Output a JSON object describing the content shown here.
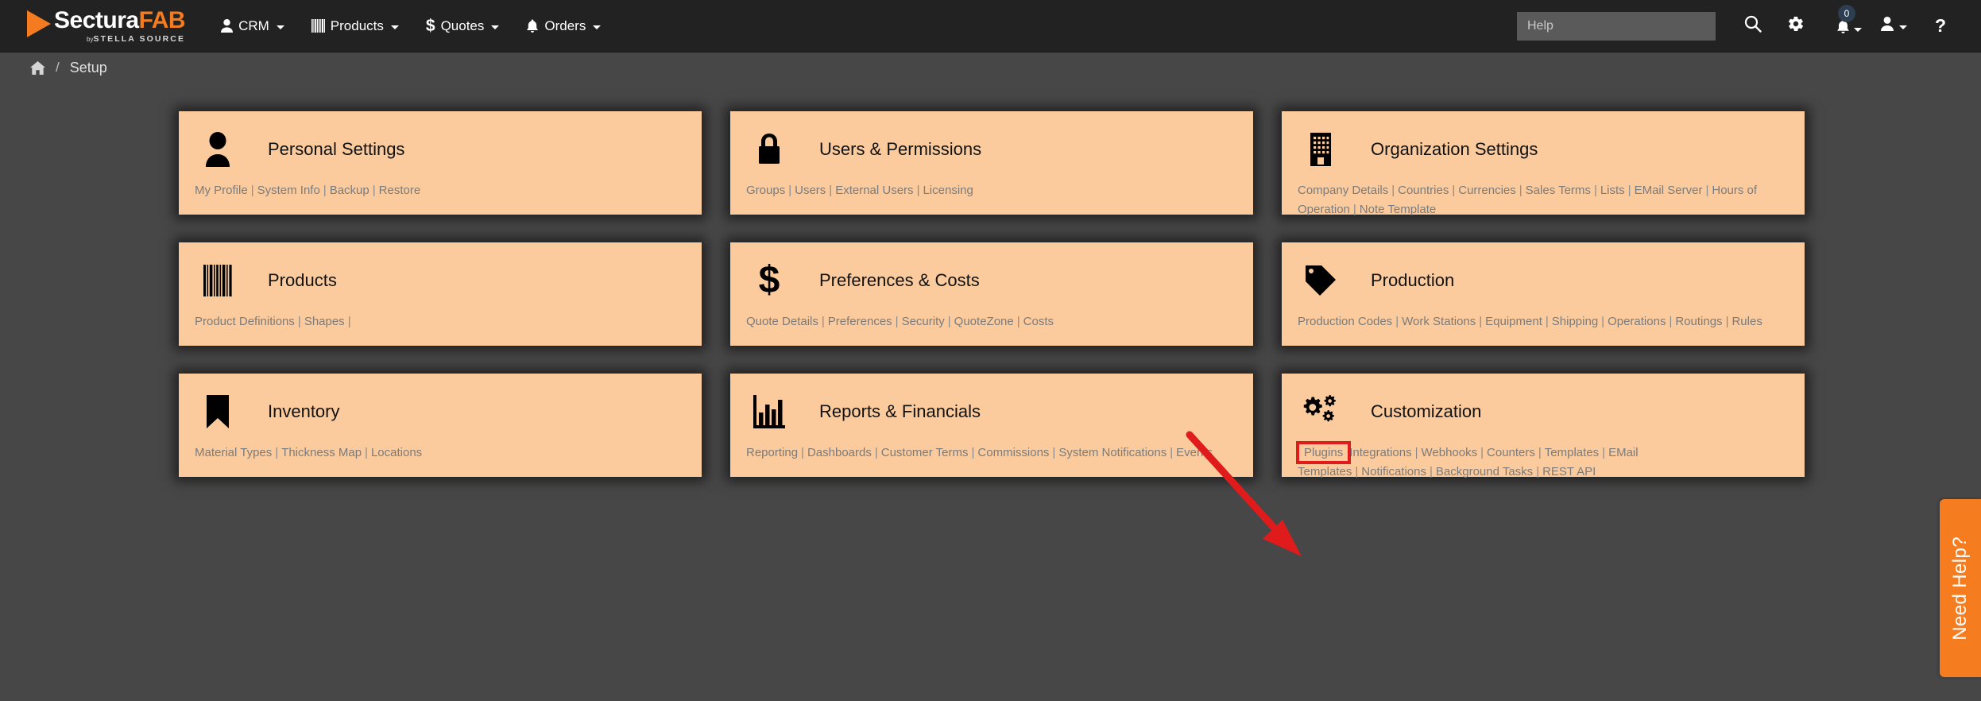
{
  "brand": {
    "name_part1": "Sectura",
    "name_part2": "FAB",
    "by": "by",
    "parent": "STELLA SOURCE",
    "accent_color": "#F47B20"
  },
  "topnav": {
    "items": [
      {
        "label": "CRM",
        "icon": "user-icon",
        "has_caret": true
      },
      {
        "label": "Products",
        "icon": "barcode-icon",
        "has_caret": true
      },
      {
        "label": "Quotes",
        "icon": "dollar-icon",
        "has_caret": true
      },
      {
        "label": "Orders",
        "icon": "bell-icon",
        "has_caret": true
      }
    ],
    "search": {
      "placeholder": "Help",
      "value": ""
    },
    "search_icon": "search-icon",
    "settings_icon": "gear-icon",
    "notifications_icon": "bell-icon",
    "notifications_count": "0",
    "account_icon": "user-icon",
    "help_icon": "question-mark-icon"
  },
  "breadcrumb": {
    "home_icon": "home-icon",
    "separator": "/",
    "current": "Setup"
  },
  "cards": [
    {
      "title": "Personal Settings",
      "icon": "person-icon",
      "links": [
        "My Profile",
        "System Info",
        "Backup",
        "Restore"
      ],
      "trailing_separator": false
    },
    {
      "title": "Users & Permissions",
      "icon": "lock-icon",
      "links": [
        "Groups",
        "Users",
        "External Users",
        "Licensing"
      ],
      "trailing_separator": false
    },
    {
      "title": "Organization Settings",
      "icon": "building-icon",
      "links": [
        "Company Details",
        "Countries",
        "Currencies",
        "Sales Terms",
        "Lists",
        "EMail Server",
        "Hours of Operation",
        "Note Template"
      ],
      "trailing_separator": false
    },
    {
      "title": "Products",
      "icon": "barcode-icon",
      "links": [
        "Product Definitions",
        "Shapes"
      ],
      "trailing_separator": true
    },
    {
      "title": "Preferences & Costs",
      "icon": "dollar-icon",
      "links": [
        "Quote Details",
        "Preferences",
        "Security",
        "QuoteZone",
        "Costs"
      ],
      "trailing_separator": false
    },
    {
      "title": "Production",
      "icon": "tag-icon",
      "links": [
        "Production Codes",
        "Work Stations",
        "Equipment",
        "Shipping",
        "Operations",
        "Routings",
        "Rules"
      ],
      "trailing_separator": false
    },
    {
      "title": "Inventory",
      "icon": "bookmark-icon",
      "links": [
        "Material Types",
        "Thickness Map",
        "Locations"
      ],
      "trailing_separator": false
    },
    {
      "title": "Reports & Financials",
      "icon": "bar-chart-icon",
      "links": [
        "Reporting",
        "Dashboards",
        "Customer Terms",
        "Commissions",
        "System Notifications",
        "Events"
      ],
      "trailing_separator": false
    },
    {
      "title": "Customization",
      "icon": "gears-icon",
      "links": [
        "Plugins",
        "Integrations",
        "Webhooks",
        "Counters",
        "Templates",
        "EMail Templates",
        "Notifications",
        "Background Tasks",
        "REST API"
      ],
      "highlighted_link": "Plugins",
      "trailing_separator": false
    }
  ],
  "annotation": {
    "arrow_color": "#E01B1B",
    "highlight_color": "#E01B1B",
    "highlight_target": "Plugins"
  },
  "need_help": {
    "label": "Need Help?",
    "color": "#F57C1F"
  },
  "theme": {
    "card_background": "#FBCB9D",
    "page_background": "#474747",
    "nav_background": "#222222",
    "link_color": "#7B7B7B"
  }
}
